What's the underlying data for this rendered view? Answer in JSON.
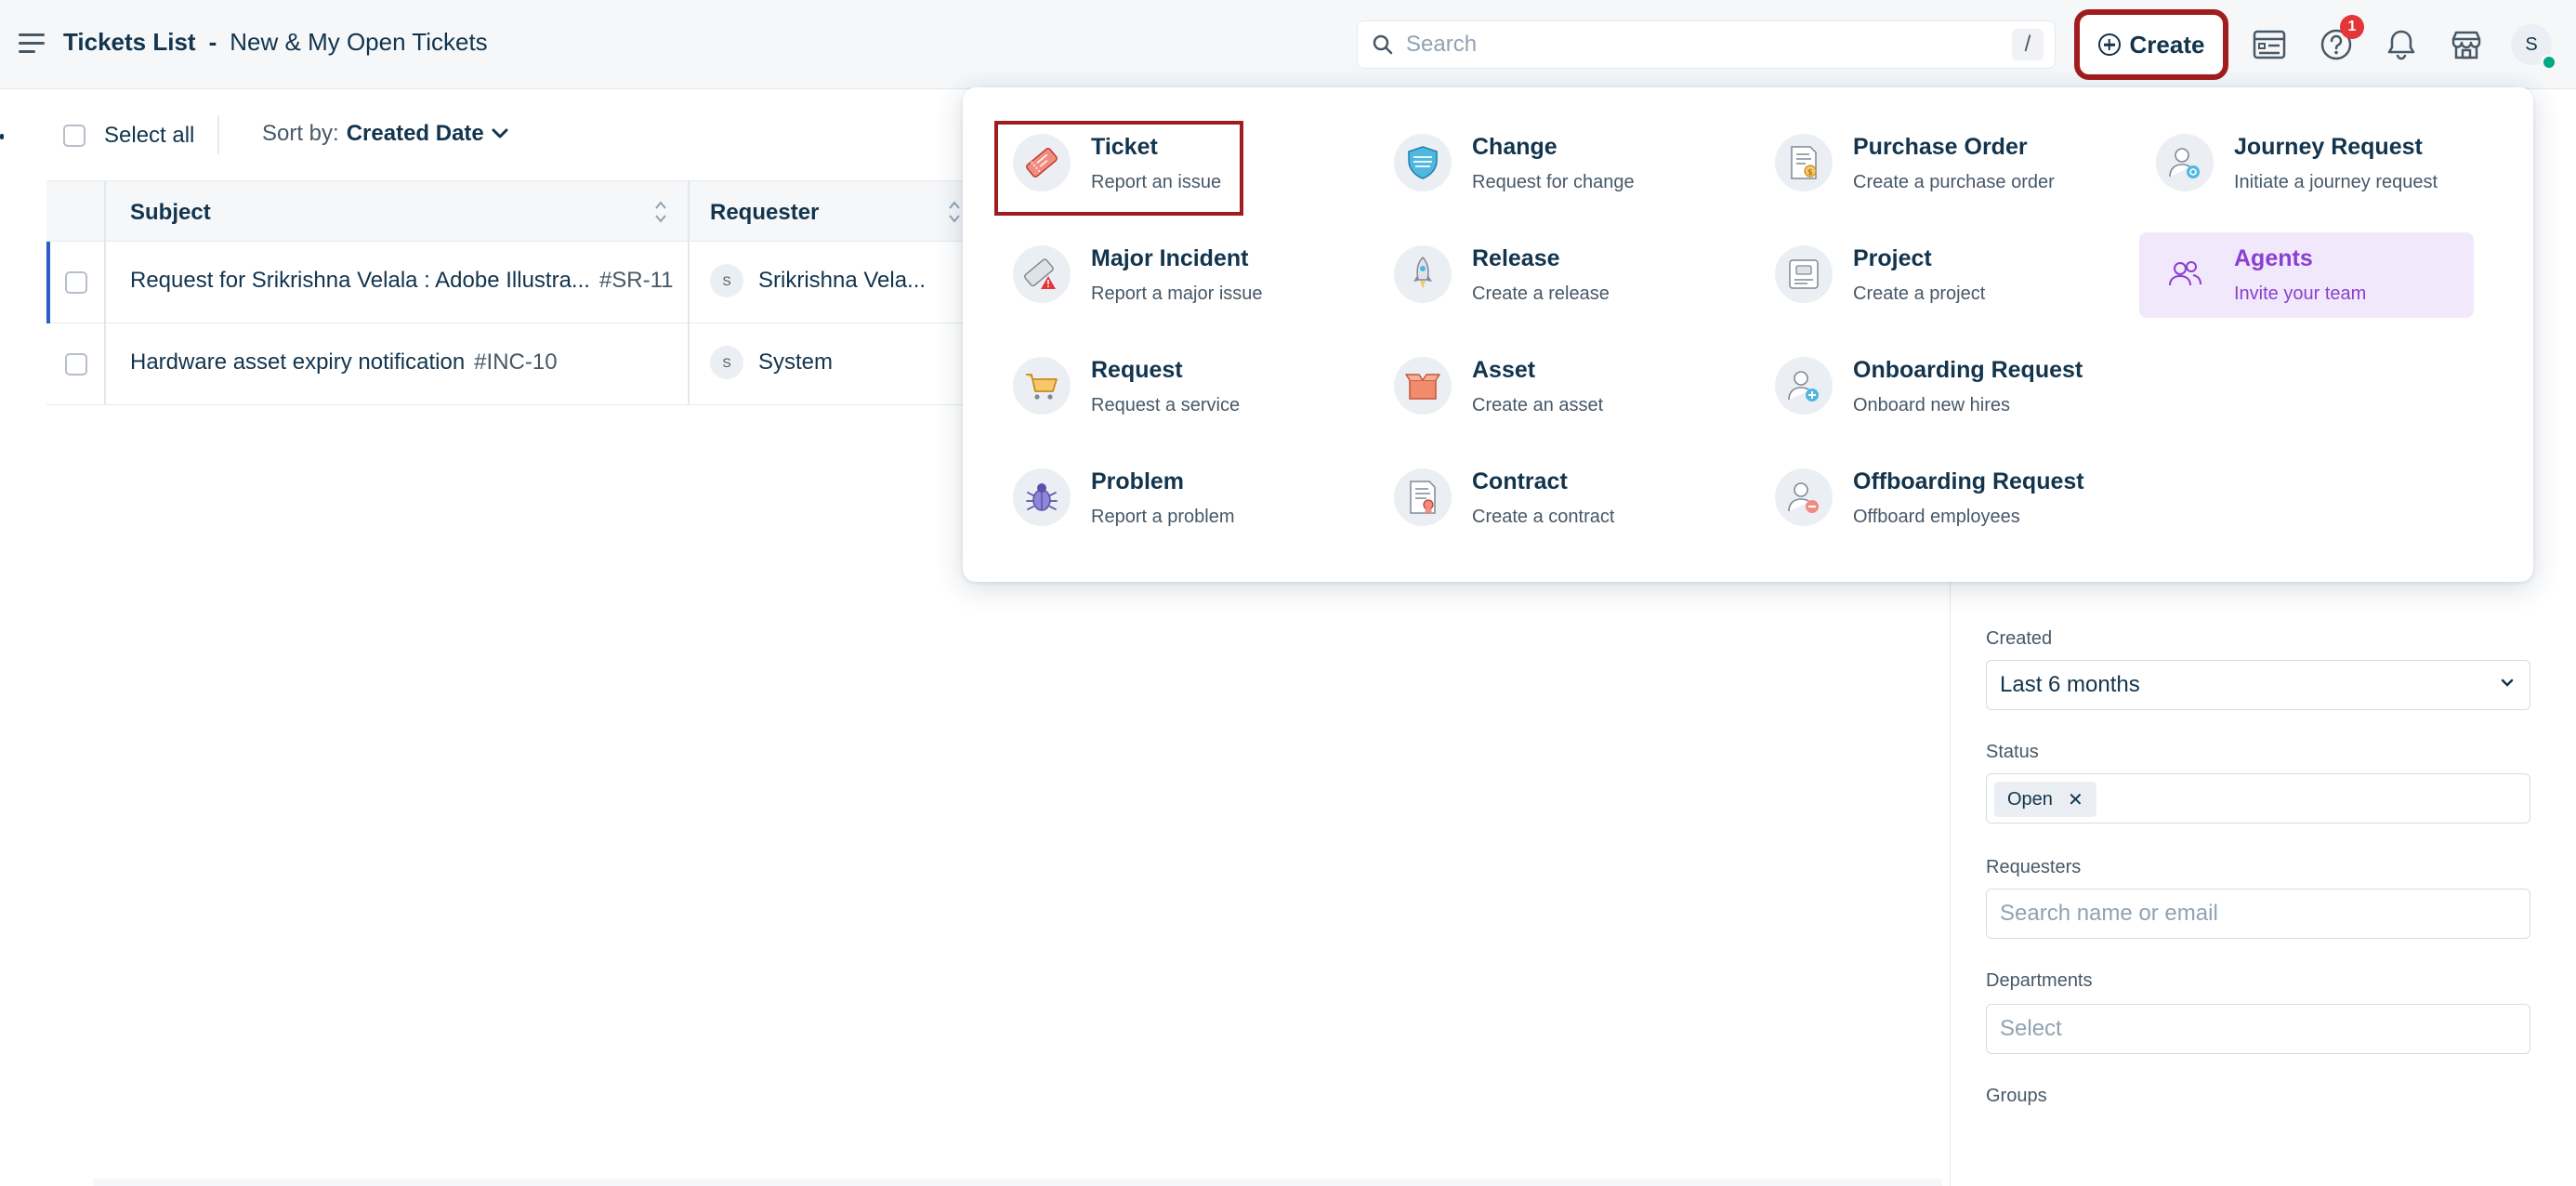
{
  "header": {
    "title": "Tickets List",
    "separator": "-",
    "view_name": "New & My Open Tickets",
    "search_placeholder": "Search",
    "search_shortcut": "/",
    "create_label": "Create",
    "help_badge_count": "1",
    "avatar_initial": "S"
  },
  "toolbar": {
    "select_all_label": "Select all",
    "sort_by_label": "Sort by:",
    "sort_by_value": "Created Date"
  },
  "table": {
    "columns": [
      "Subject",
      "Requester"
    ],
    "rows": [
      {
        "subject": "Request for Srikrishna Velala : Adobe Illustra...",
        "id": "#SR-11",
        "requester_initial": "S",
        "requester": "Srikrishna Vela..."
      },
      {
        "subject": "Hardware asset expiry notification",
        "id": "#INC-10",
        "requester_initial": "S",
        "requester": "System"
      }
    ]
  },
  "create_menu": {
    "items": [
      {
        "title": "Ticket",
        "subtitle": "Report an issue",
        "icon": "ticket-icon"
      },
      {
        "title": "Change",
        "subtitle": "Request for change",
        "icon": "change-shield-icon"
      },
      {
        "title": "Purchase Order",
        "subtitle": "Create a purchase order",
        "icon": "purchase-order-icon"
      },
      {
        "title": "Journey Request",
        "subtitle": "Initiate a journey request",
        "icon": "journey-user-icon"
      },
      {
        "title": "Major Incident",
        "subtitle": "Report a major issue",
        "icon": "major-incident-icon"
      },
      {
        "title": "Release",
        "subtitle": "Create a release",
        "icon": "rocket-icon"
      },
      {
        "title": "Project",
        "subtitle": "Create a project",
        "icon": "project-icon"
      },
      {
        "title": "Agents",
        "subtitle": "Invite your team",
        "icon": "agents-icon"
      },
      {
        "title": "Request",
        "subtitle": "Request a service",
        "icon": "cart-icon"
      },
      {
        "title": "Asset",
        "subtitle": "Create an asset",
        "icon": "asset-box-icon"
      },
      {
        "title": "Onboarding Request",
        "subtitle": "Onboard new hires",
        "icon": "onboarding-user-icon"
      },
      {
        "title": "Problem",
        "subtitle": "Report a problem",
        "icon": "bug-icon"
      },
      {
        "title": "Contract",
        "subtitle": "Create a contract",
        "icon": "contract-icon"
      },
      {
        "title": "Offboarding Request",
        "subtitle": "Offboard employees",
        "icon": "offboarding-user-icon"
      }
    ]
  },
  "filters": {
    "created_label": "Created",
    "created_value": "Last 6 months",
    "status_label": "Status",
    "status_chip": "Open",
    "requesters_label": "Requesters",
    "requesters_placeholder": "Search name or email",
    "departments_label": "Departments",
    "departments_placeholder": "Select",
    "groups_label": "Groups"
  },
  "colors": {
    "highlight_border": "#a11d1d",
    "agents_highlight_bg": "#f1e9fb",
    "agents_text": "#8a3fd0",
    "badge_red": "#e43538",
    "online_green": "#00a886",
    "row_accent_blue": "#2c5cc5"
  }
}
